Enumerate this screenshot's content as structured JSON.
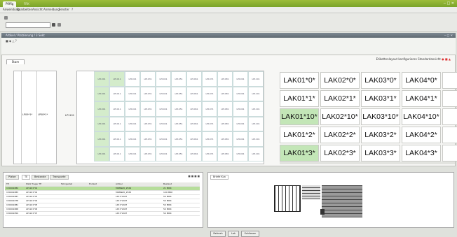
{
  "titlebar": {
    "tab_active": "Pfiffig",
    "tab_other": "FRK"
  },
  "menu": [
    "Anwendung",
    "Bearbeiten",
    "Ansicht",
    "Anmeldung",
    "Fenster",
    "?"
  ],
  "view_title": "Artikel / Platzierung / 3 Sekt",
  "inner_tab": "Stam",
  "right_toolbar": "Etikettenlayout konfigurieren  Standardansicht",
  "left_labels": [
    "LP09*1*",
    "LP08*1*"
  ],
  "mid_row_label": "LP1101",
  "mid_cells": [
    "LP1001",
    "LP1011",
    "LP1021",
    "LP1031",
    "LP1041",
    "LP1051",
    "LP1061",
    "LP1071",
    "LP1081",
    "LP1091",
    "LP1101"
  ],
  "lak": [
    [
      "LAK01*0*",
      "LAK02*0*",
      "LAK03*0*",
      "LAK04*0*",
      "LA"
    ],
    [
      "LAK01*1*",
      "LAK02*1*",
      "LAK03*1*",
      "LAK04*1*",
      "LA"
    ],
    [
      "LAK01*10*",
      "LAK02*10*",
      "LAK03*10*",
      "LAK04*10*",
      "LA"
    ],
    [
      "LAK01*2*",
      "LAK02*2*",
      "LAK03*2*",
      "LAK04*2*",
      "LA"
    ],
    [
      "LAK01*3*",
      "LAK02*3*",
      "LAK03*3*",
      "LAK04*3*",
      "LA"
    ]
  ],
  "lak_green_rows": [
    2,
    4
  ],
  "bottom_tabs": [
    "Platze",
    "TE",
    "Bestande",
    "Transporte"
  ],
  "table": {
    "headers": [
      "TE",
      "Platz Trager TE",
      "Fahrgestell",
      "Endzeit",
      "Artikel",
      "Bestand"
    ],
    "rows": [
      [
        "150001882",
        "LP1101*01",
        "",
        "",
        "MRNNZ0_2564",
        "21 MRR"
      ],
      [
        "150001883",
        "LP1101*02",
        "",
        "",
        "MRNNZ0_2565",
        "100 MRR"
      ],
      [
        "150001887",
        "LP1101*03",
        "",
        "",
        "LP11*204T",
        "50 MRR"
      ],
      [
        "150001878",
        "LP1101*04",
        "",
        "",
        "LP11*204T",
        "50 MRR"
      ],
      [
        "150001881",
        "LP1101*05",
        "",
        "",
        "LP11*204T",
        "50 MRR"
      ],
      [
        "150001868",
        "LP1101*06",
        "",
        "",
        "LP11*204T",
        "50 MRR"
      ],
      [
        "150001859",
        "LP1101*07",
        "",
        "",
        "LP11*204T",
        "50 MRR"
      ]
    ]
  },
  "right_tab": "Briefe Kun",
  "buttons": [
    "Refresh",
    "Lok",
    "Schliesen"
  ]
}
